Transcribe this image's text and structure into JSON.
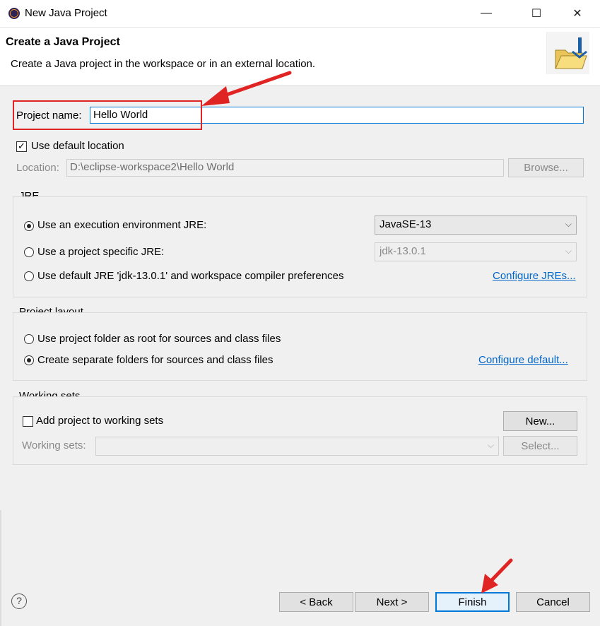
{
  "window": {
    "title": "New Java Project",
    "controls": {
      "minimize": "—",
      "maximize": "☐",
      "close": "✕"
    }
  },
  "banner": {
    "title": "Create a Java Project",
    "description": "Create a Java project in the workspace or in an external location."
  },
  "project_name": {
    "label": "Project name:",
    "value": "Hello World"
  },
  "location": {
    "use_default_label": "Use default location",
    "use_default_checked": true,
    "label": "Location:",
    "value": "D:\\eclipse-workspace2\\Hello World",
    "browse_label": "Browse..."
  },
  "jre": {
    "group_label": "JRE",
    "option_exec_env": "Use an execution environment JRE:",
    "exec_env_value": "JavaSE-13",
    "option_project_specific": "Use a project specific JRE:",
    "project_specific_value": "jdk-13.0.1",
    "option_default": "Use default JRE 'jdk-13.0.1' and workspace compiler preferences",
    "configure_link": "Configure JREs...",
    "selected": "exec_env"
  },
  "project_layout": {
    "group_label": "Project layout",
    "option_root": "Use project folder as root for sources and class files",
    "option_separate": "Create separate folders for sources and class files",
    "configure_link": "Configure default...",
    "selected": "separate"
  },
  "working_sets": {
    "group_label": "Working sets",
    "add_label": "Add project to working sets",
    "add_checked": false,
    "new_label": "New...",
    "sets_label": "Working sets:",
    "sets_value": "",
    "select_label": "Select..."
  },
  "footer": {
    "help": "?",
    "back_label": "< Back",
    "next_label": "Next >",
    "finish_label": "Finish",
    "cancel_label": "Cancel"
  },
  "colors": {
    "annotation": "#e02424",
    "link": "#0066cc",
    "focus": "#0078d7"
  }
}
